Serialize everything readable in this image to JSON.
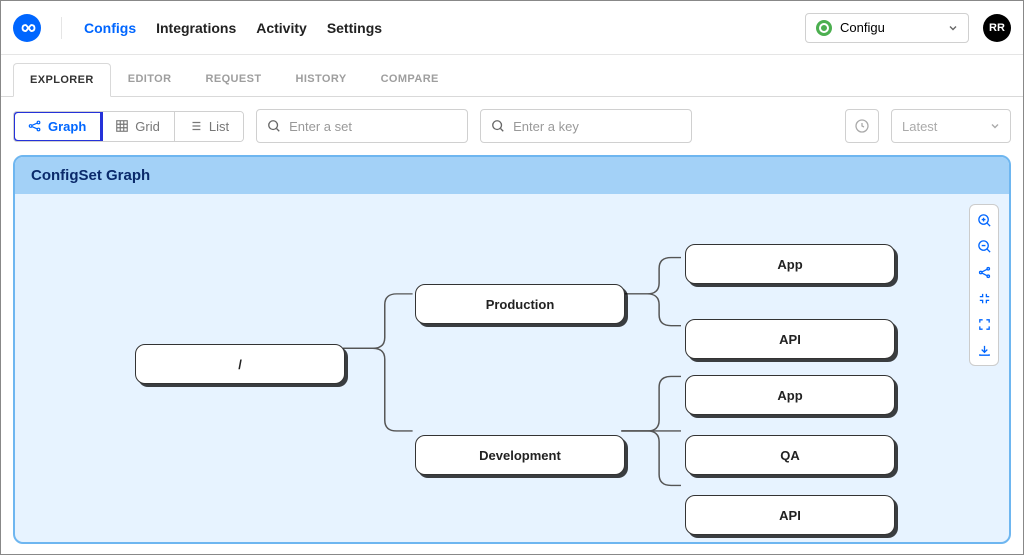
{
  "header": {
    "nav": [
      {
        "label": "Configs",
        "active": true
      },
      {
        "label": "Integrations",
        "active": false
      },
      {
        "label": "Activity",
        "active": false
      },
      {
        "label": "Settings",
        "active": false
      }
    ],
    "workspace_name": "Configu",
    "avatar_initials": "RR"
  },
  "subtabs": [
    {
      "label": "EXPLORER",
      "active": true
    },
    {
      "label": "EDITOR",
      "active": false
    },
    {
      "label": "REQUEST",
      "active": false
    },
    {
      "label": "HISTORY",
      "active": false
    },
    {
      "label": "COMPARE",
      "active": false
    }
  ],
  "toolbar": {
    "views": [
      {
        "label": "Graph",
        "active": true,
        "highlighted": true
      },
      {
        "label": "Grid",
        "active": false,
        "highlighted": false
      },
      {
        "label": "List",
        "active": false,
        "highlighted": false
      }
    ],
    "set_placeholder": "Enter a set",
    "key_placeholder": "Enter a key",
    "latest_label": "Latest"
  },
  "panel": {
    "title": "ConfigSet Graph",
    "nodes": {
      "root": "/",
      "production": "Production",
      "development": "Development",
      "prod_app": "App",
      "prod_api": "API",
      "dev_app": "App",
      "dev_qa": "QA",
      "dev_api": "API"
    }
  }
}
